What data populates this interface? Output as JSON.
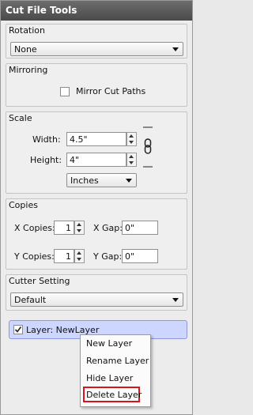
{
  "app": {
    "title": "Cut File Tools"
  },
  "rotation": {
    "label": "Rotation",
    "selected": "None"
  },
  "mirroring": {
    "label": "Mirroring",
    "checkbox_label": "Mirror Cut Paths",
    "checked": false
  },
  "scale": {
    "label": "Scale",
    "width_label": "Width:",
    "width_value": "4.5\"",
    "height_label": "Height:",
    "height_value": "4\"",
    "units_selected": "Inches"
  },
  "copies": {
    "label": "Copies",
    "x_label": "X Copies:",
    "x_value": "1",
    "x_gap_label": "X Gap:",
    "x_gap_value": "0\"",
    "y_label": "Y Copies:",
    "y_value": "1",
    "y_gap_label": "Y Gap:",
    "y_gap_value": "0\""
  },
  "cutter": {
    "label": "Cutter Setting",
    "selected": "Default"
  },
  "layer": {
    "label": "Layer: NewLayer",
    "checked": true
  },
  "context_menu": {
    "items": [
      "New Layer",
      "Rename Layer",
      "Hide Layer",
      "Delete Layer"
    ],
    "highlighted_item": "Delete Layer"
  },
  "colors": {
    "titlebar": "#555555",
    "layer_bar": "#cdd6ff",
    "highlight_border": "#d6151c"
  }
}
